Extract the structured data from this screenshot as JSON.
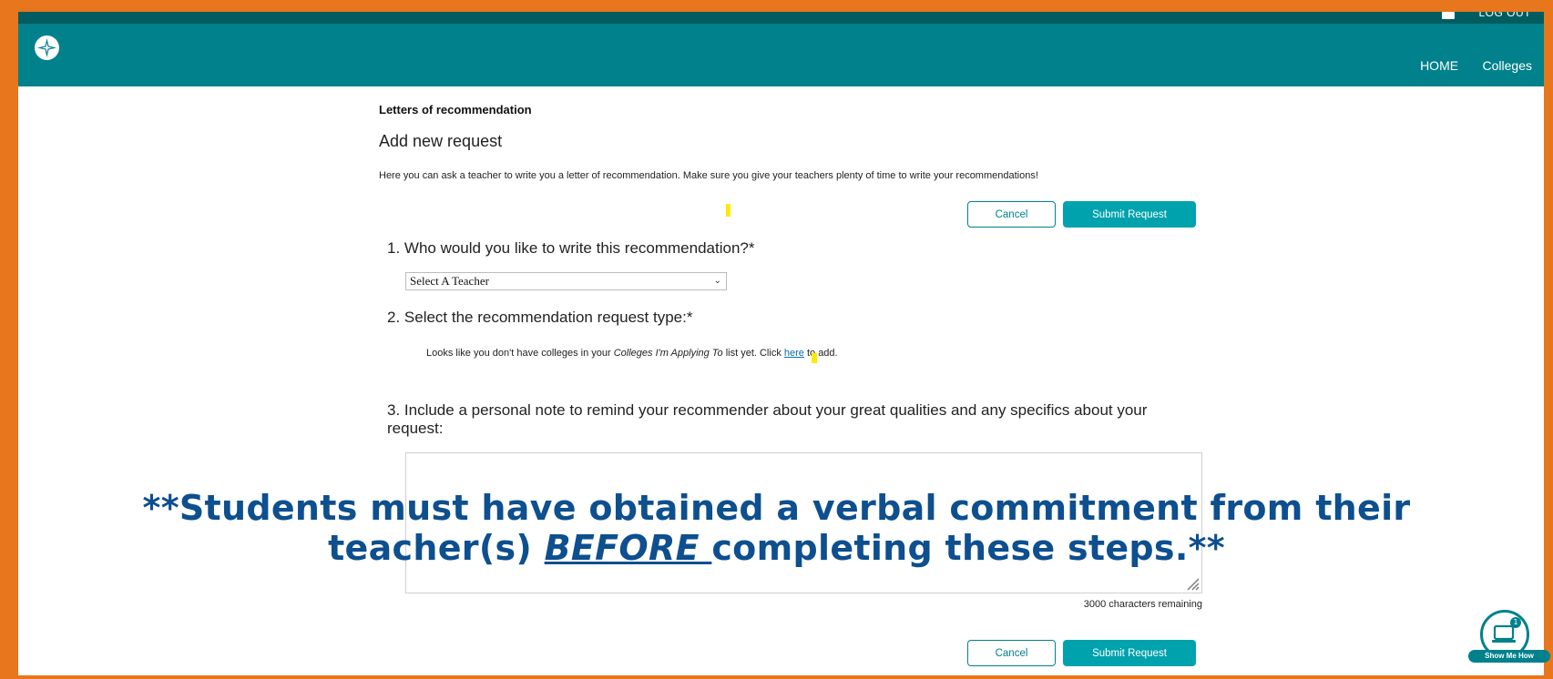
{
  "topbar": {
    "logout_label": "LOG OUT"
  },
  "nav": {
    "home": "HOME",
    "colleges": "Colleges"
  },
  "page": {
    "section_label": "Letters of recommendation",
    "title": "Add new request",
    "intro": "Here you can ask a teacher to write you a letter of recommendation. Make sure you give your teachers plenty of time to write your recommendations!"
  },
  "buttons": {
    "cancel": "Cancel",
    "submit": "Submit Request"
  },
  "questions": {
    "q1": "1. Who would you like to write this recommendation?*",
    "q2": "2. Select the recommendation request type:*",
    "q3": "3. Include a personal note to remind your recommender about your great qualities and any specifics about your request:"
  },
  "teacher_select": {
    "value": "Select A Teacher"
  },
  "no_colleges": {
    "part1": "Looks like you don't have colleges in your ",
    "list_name": "Colleges I'm Applying To",
    "part2": " list yet. Click ",
    "link": "here",
    "part3": " to add."
  },
  "note": {
    "chars_remaining": "3000 characters remaining"
  },
  "overlay": {
    "line1": "**Students must have obtained a verbal commitment from their",
    "line2_pre": "teacher(s) ",
    "line2_em": "BEFORE ",
    "line2_post": "completing these steps.**"
  },
  "show_me_how": {
    "label": "Show Me How",
    "badge": "1"
  },
  "colors": {
    "nav": "#00818b",
    "topstrip": "#005c5e",
    "accent": "#00a3ad",
    "frame": "#e8761d",
    "overlay_text": "#0d4f8f"
  }
}
